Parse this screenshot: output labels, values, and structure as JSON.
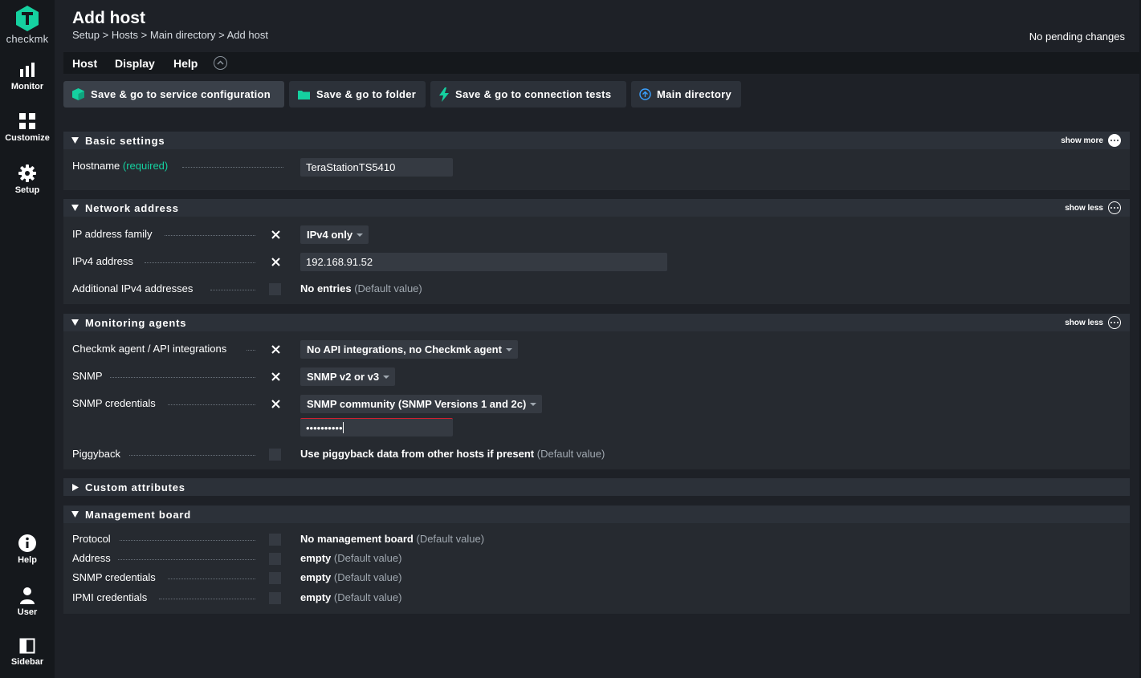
{
  "app": {
    "name": "checkmk"
  },
  "sidebar": {
    "items": [
      {
        "label": "Monitor",
        "icon": "monitor-icon"
      },
      {
        "label": "Customize",
        "icon": "customize-icon"
      },
      {
        "label": "Setup",
        "icon": "gear-icon"
      },
      {
        "label": "Help",
        "icon": "info-icon"
      },
      {
        "label": "User",
        "icon": "user-icon"
      },
      {
        "label": "Sidebar",
        "icon": "sidebar-icon"
      }
    ]
  },
  "header": {
    "title": "Add host",
    "breadcrumb": [
      "Setup",
      "Hosts",
      "Main directory",
      "Add host"
    ],
    "breadcrumb_sep": " > ",
    "pending": "No pending changes"
  },
  "menubar": {
    "items": [
      "Host",
      "Display",
      "Help"
    ]
  },
  "actions": [
    {
      "label": "Save & go to service configuration",
      "icon": "cube-icon"
    },
    {
      "label": "Save & go to folder",
      "icon": "folder-icon"
    },
    {
      "label": "Save & go to connection tests",
      "icon": "lightning-icon"
    },
    {
      "label": "Main directory",
      "icon": "arrow-up-circle-icon"
    }
  ],
  "sections": {
    "basic": {
      "title": "Basic settings",
      "toggle": "show more",
      "hostname_label": "Hostname",
      "hostname_required": "(required)",
      "hostname_value": "TeraStationTS5410"
    },
    "network": {
      "title": "Network address",
      "toggle": "show less",
      "ip_family_label": "IP address family",
      "ip_family_value": "IPv4 only",
      "ipv4_label": "IPv4 address",
      "ipv4_value": "192.168.91.52",
      "additional_label": "Additional IPv4 addresses",
      "additional_value": "No entries",
      "additional_default": "(Default value)"
    },
    "monitoring": {
      "title": "Monitoring agents",
      "toggle": "show less",
      "agent_label": "Checkmk agent / API integrations",
      "agent_value": "No API integrations, no Checkmk agent",
      "snmp_label": "SNMP",
      "snmp_value": "SNMP v2 or v3",
      "snmp_cred_label": "SNMP credentials",
      "snmp_cred_value": "SNMP community (SNMP Versions 1 and 2c)",
      "snmp_community_value": "••••••••••",
      "piggyback_label": "Piggyback",
      "piggyback_value": "Use piggyback data from other hosts if present",
      "piggyback_default": "(Default value)"
    },
    "custom": {
      "title": "Custom attributes"
    },
    "management": {
      "title": "Management board",
      "rows": [
        {
          "label": "Protocol",
          "value": "No management board",
          "default": "(Default value)"
        },
        {
          "label": "Address",
          "value": "empty",
          "default": "(Default value)"
        },
        {
          "label": "SNMP credentials",
          "value": "empty",
          "default": "(Default value)"
        },
        {
          "label": "IPMI credentials",
          "value": "empty",
          "default": "(Default value)"
        }
      ]
    }
  },
  "colors": {
    "accent": "#15d1a0",
    "bg": "#1e2127",
    "panel": "#262a30",
    "sidebar": "#15181c"
  }
}
